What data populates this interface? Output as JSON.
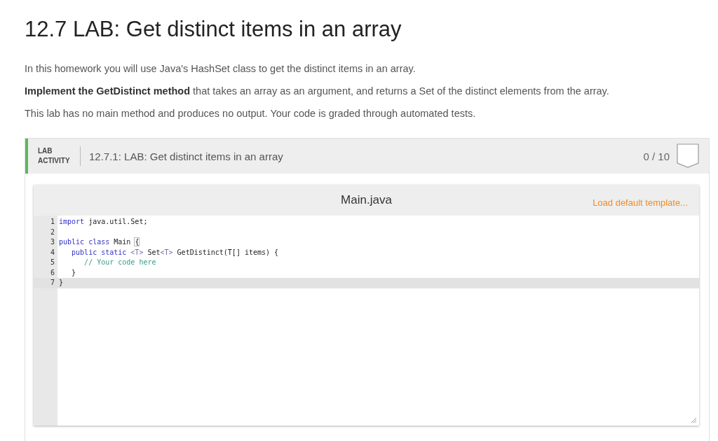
{
  "title": "12.7 LAB: Get distinct items in an array",
  "paragraphs": [
    "In this homework you will use Java's HashSet class to get the distinct items in an array.",
    "**Implement the GetDistinct method** that takes an array as an argument, and returns a Set of the distinct elements from the array.",
    "This lab has no main method and produces no output. Your code is graded through automated tests."
  ],
  "activity": {
    "type_label": "LAB ACTIVITY",
    "title": "12.7.1: LAB: Get distinct items in an array",
    "score": "0 / 10",
    "completed": false
  },
  "editor": {
    "filename": "Main.java",
    "template_link": "Load default template...",
    "lines": [
      {
        "number": "1",
        "current": false,
        "tokens": [
          {
            "kind": "keyword",
            "text": "import"
          },
          {
            "kind": "plain",
            "text": " java.util.Set;"
          }
        ]
      },
      {
        "number": "2",
        "current": false
      },
      {
        "number": "3",
        "current": false,
        "tokens": [
          {
            "kind": "keyword",
            "text": "public class"
          },
          {
            "kind": "plain",
            "text": " Main "
          },
          {
            "kind": "bracket",
            "text": "{"
          }
        ]
      },
      {
        "number": "4",
        "current": false,
        "tokens": [
          {
            "kind": "keyword",
            "text": "   public static"
          },
          {
            "kind": "generic",
            "text": " <T>"
          },
          {
            "kind": "plain",
            "text": " Set"
          },
          {
            "kind": "generic",
            "text": "<T>"
          },
          {
            "kind": "plain",
            "text": " GetDistinct(T[] items) {"
          }
        ]
      },
      {
        "number": "5",
        "current": false,
        "tokens": [
          {
            "kind": "comment",
            "text": "      // Your code here"
          }
        ]
      },
      {
        "number": "6",
        "current": false,
        "tokens": [
          {
            "kind": "plain",
            "text": "   }"
          }
        ]
      },
      {
        "number": "7",
        "current": true,
        "tokens": [
          {
            "kind": "plain",
            "text": "}"
          }
        ]
      }
    ]
  }
}
